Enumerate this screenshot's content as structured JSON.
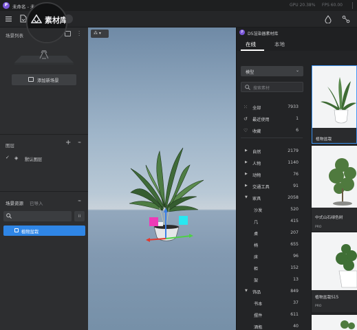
{
  "titlebar": {
    "app_initial": "P",
    "title": "未命名 - 未",
    "gpu": "GPU 20.38%",
    "fps": "FPS 60.00"
  },
  "toolbar": {
    "magnifier_label": "素材库"
  },
  "left": {
    "scene_list_title": "场景列表",
    "add_scene_label": "添加新场景",
    "layers_title": "图层",
    "default_layer": "默认图层",
    "assets_tab": "场景资源",
    "imported_tab": "已导入",
    "asset_item": "植物盆栽"
  },
  "library": {
    "window_title": "D5渲染器素材库",
    "tab_online": "在线",
    "tab_local": "本地",
    "type_select": "模型",
    "search_placeholder": "搜索素材",
    "quick": [
      {
        "icon": "grid-icon",
        "label": "全部",
        "count": "7933"
      },
      {
        "icon": "recent-icon",
        "label": "最近使用",
        "count": "1"
      },
      {
        "icon": "heart-icon",
        "label": "收藏",
        "count": "6"
      }
    ],
    "categories": [
      {
        "label": "自然",
        "count": "2179",
        "state": "collapsed",
        "level": 0
      },
      {
        "label": "人物",
        "count": "1140",
        "state": "collapsed",
        "level": 0
      },
      {
        "label": "动物",
        "count": "76",
        "state": "collapsed",
        "level": 0
      },
      {
        "label": "交通工具",
        "count": "91",
        "state": "collapsed",
        "level": 0
      },
      {
        "label": "家具",
        "count": "2058",
        "state": "expanded",
        "level": 0
      },
      {
        "label": "沙发",
        "count": "520",
        "state": "",
        "level": 1
      },
      {
        "label": "几",
        "count": "415",
        "state": "",
        "level": 1
      },
      {
        "label": "桌",
        "count": "207",
        "state": "",
        "level": 1
      },
      {
        "label": "椅",
        "count": "655",
        "state": "",
        "level": 1
      },
      {
        "label": "床",
        "count": "96",
        "state": "",
        "level": 1
      },
      {
        "label": "柜",
        "count": "152",
        "state": "",
        "level": 1
      },
      {
        "label": "架",
        "count": "13",
        "state": "",
        "level": 1
      },
      {
        "label": "饰品",
        "count": "849",
        "state": "expanded",
        "level": 0
      },
      {
        "label": "书本",
        "count": "37",
        "state": "",
        "level": 1
      },
      {
        "label": "摆件",
        "count": "611",
        "state": "",
        "level": 1
      },
      {
        "label": "酒瓶",
        "count": "40",
        "state": "",
        "level": 1
      }
    ],
    "cards": [
      {
        "name": "植物盆栽",
        "badge": ""
      },
      {
        "name": "中式山石绿色树",
        "badge": "PRO"
      },
      {
        "name": "植物盆栽S15",
        "badge": "PRO"
      }
    ]
  },
  "colors": {
    "accent": "#2f7fd8",
    "selected_item": "#2f86e6",
    "gizmo_red": "#e2382d",
    "gizmo_green": "#4ed047",
    "gizmo_blue": "#3b7fe6",
    "gizmo_magenta": "#ee3bb7",
    "gizmo_cyan": "#29e7f0"
  }
}
